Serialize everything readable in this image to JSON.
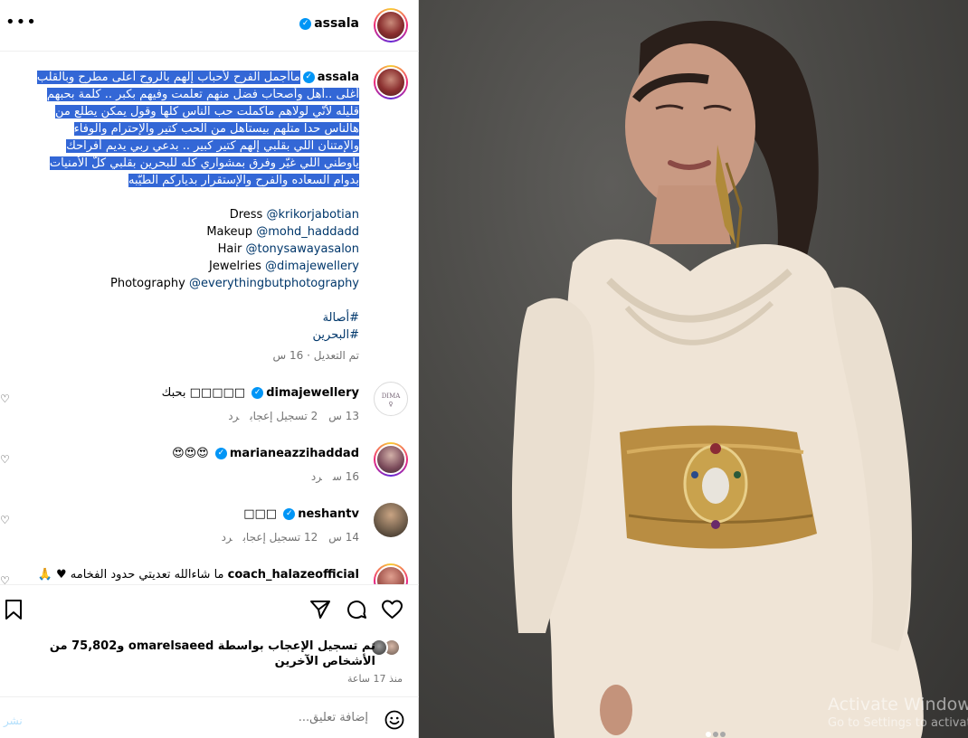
{
  "post": {
    "username": "assala",
    "caption_lines": [
      "ماأجمل الفرح لأحباب إلهم بالروح أعلى مطرح وبالقلب",
      "أغلى ..أهل وأصحاب فضل منهم تعلّمت وفيهم بكبر .. كلمة بحبهم",
      "قليله لأنّي لولاهم ماكملت حب الناس كلها وقول يمكن يطلع من",
      "هالناس حدا متلهم بيستاهل من الحب كتير والإحترام والوفاء",
      "والإمتنان اللي بقلبي إلهم كتير كبير .. بدعي ربي يديم أفراحك",
      "ياوطني اللي غيّر وفرق بمشواري كلّه للبحرين بقلبي كلّ الأمنيات",
      "بدوام السعاده والفرح والإستقرار بدياركم الطيّبه"
    ],
    "credits": [
      {
        "label": "Dress",
        "handle": "@krikorjabotian"
      },
      {
        "label": "Makeup",
        "handle": "@mohd_haddadd"
      },
      {
        "label": "Hair",
        "handle": "@tonysawayasalon"
      },
      {
        "label": "Jewelries",
        "handle": "@dimajewellery"
      },
      {
        "label": "Photography",
        "handle": "@everythingbutphotography"
      }
    ],
    "hashtags": [
      "#أصالة",
      "#البحرين"
    ],
    "edited_label": "تم التعديل · 16 س"
  },
  "comments": [
    {
      "username": "dimajewellery",
      "text": "□□□□□ بحبك",
      "time": "13 س",
      "likes": "2 تسجيل إعجاب",
      "reply": "رد",
      "avatar_color": "#efe6ee"
    },
    {
      "username": "marianeazzihaddad",
      "text": "😍😍😍",
      "time": "16 س",
      "likes": "",
      "reply": "رد",
      "avatar_color": "#8a6a7a"
    },
    {
      "username": "neshantv",
      "text": "□□□",
      "time": "14 س",
      "likes": "12 تسجيل إعجاب",
      "reply": "رد",
      "avatar_color": "#6b5a48"
    },
    {
      "username": "coach_halazeofficial",
      "text": "ما شاءالله تعديتي حدود الفخامه ♥ 🙏",
      "time": "",
      "likes": "",
      "reply": "",
      "avatar_color": "#a0524a"
    }
  ],
  "likes": {
    "text": "تم تسجيل الإعجاب بواسطة omarelsaeed و75,802 من الأشخاص الآخرين",
    "time": "منذ 17 ساعة"
  },
  "add_comment": {
    "placeholder": "إضافة تعليق...",
    "post_label": "نشر"
  },
  "windows_watermark": {
    "title": "Activate Windows",
    "subtitle": "Go to Settings to activate Windows."
  },
  "colors": {
    "accent": "#0095f6",
    "selection": "#3367d6",
    "link": "#00376b",
    "muted": "#737373"
  },
  "icons": [
    "more-icon",
    "verified-icon",
    "bookmark-icon",
    "share-icon",
    "comment-icon",
    "heart-icon",
    "emoji-icon"
  ]
}
